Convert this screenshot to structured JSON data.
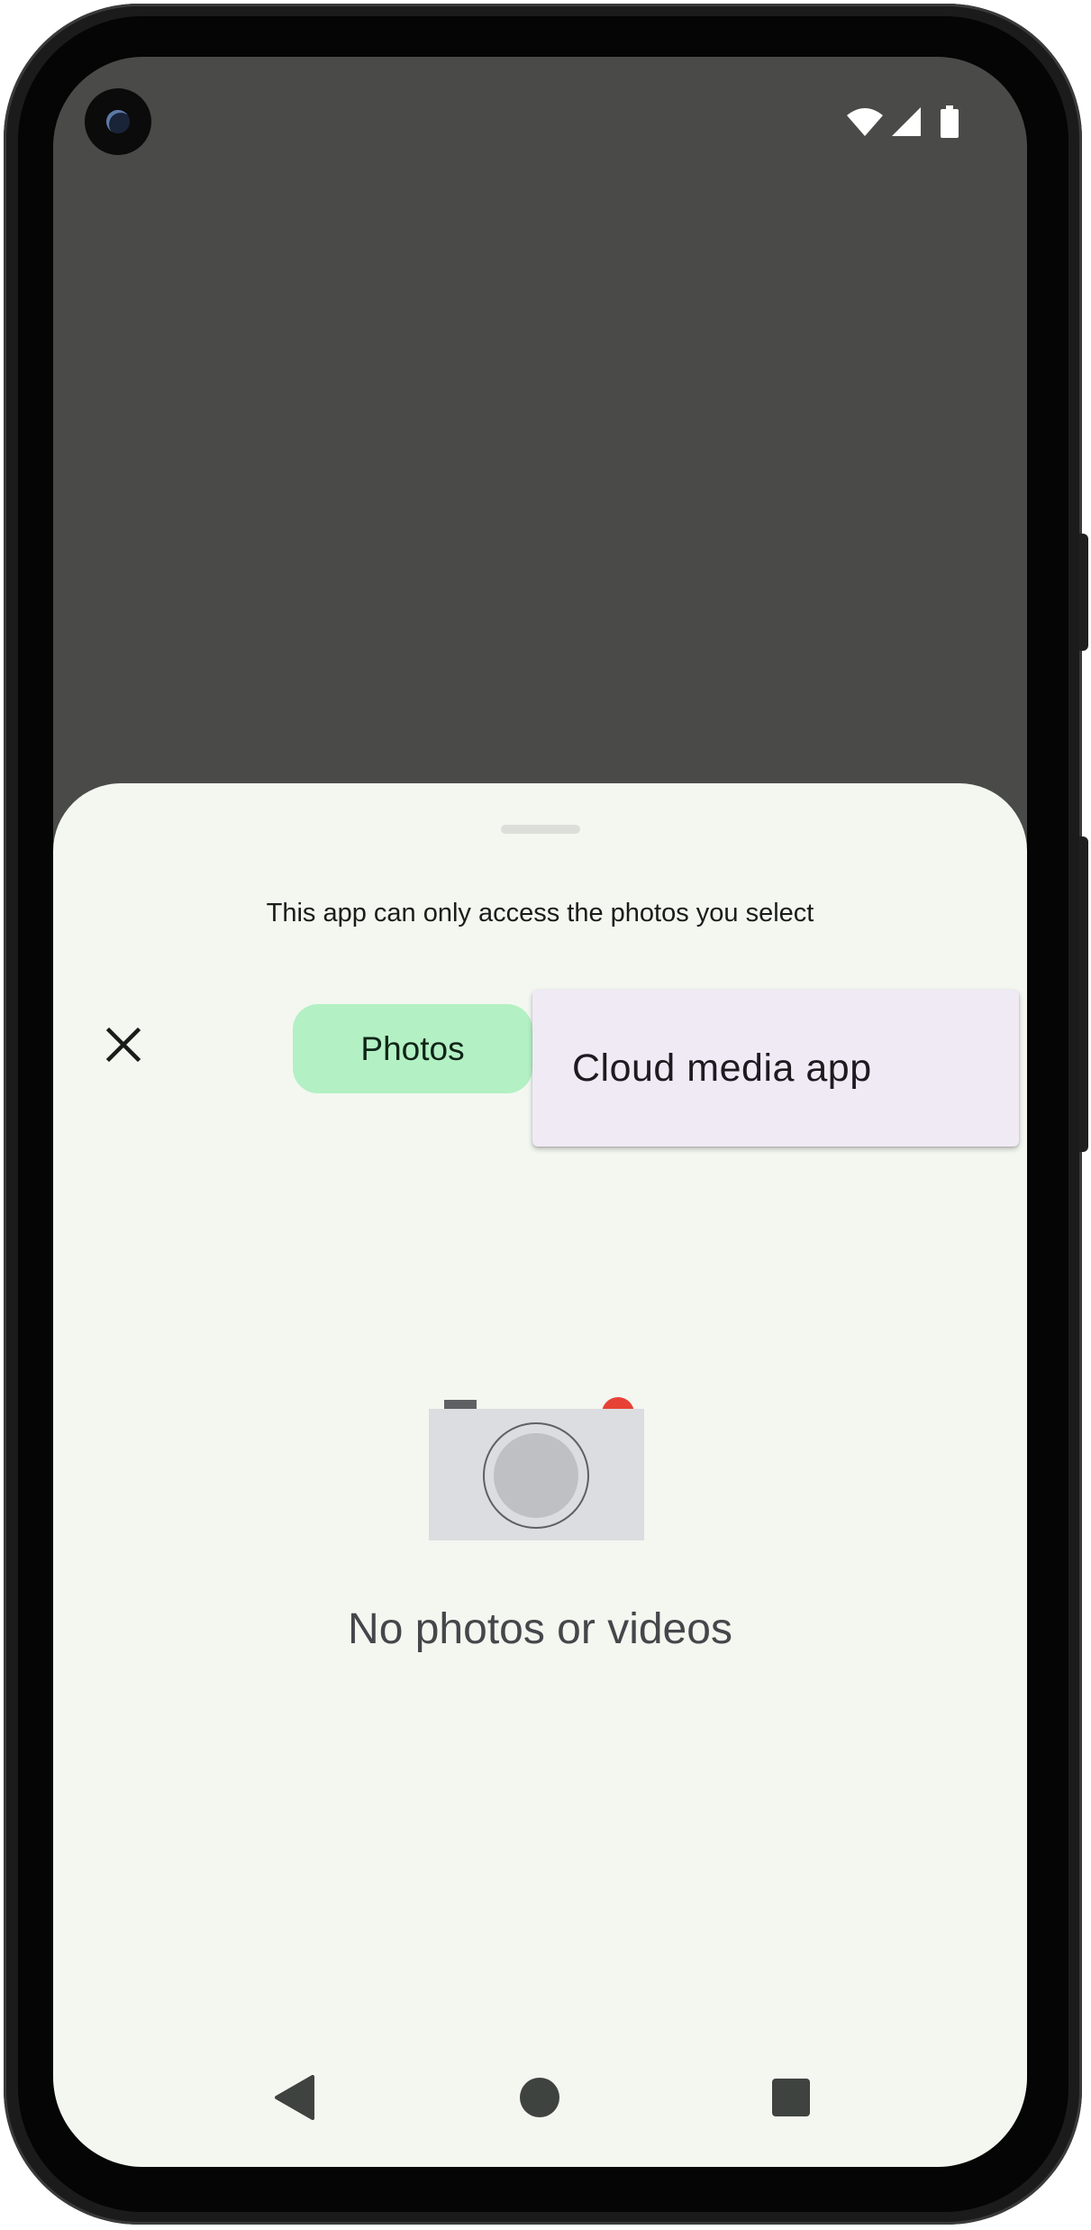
{
  "sheet": {
    "subtitle": "This app can only access the photos you select",
    "close_icon": "close-icon",
    "tabs": [
      {
        "label": "Photos",
        "selected": true
      }
    ],
    "dropdown": {
      "items": [
        {
          "label": "Cloud media app"
        }
      ]
    },
    "empty_state": {
      "illustration": "camera-illustration",
      "label": "No photos or videos"
    }
  },
  "status_bar": {
    "icons": [
      "wifi-icon",
      "cellular-signal-icon",
      "battery-icon"
    ]
  },
  "nav_bar": {
    "buttons": [
      "back-icon",
      "home-icon",
      "recents-icon"
    ]
  },
  "colors": {
    "scrim": "#4a4b49",
    "sheet_background": "#f3f7f0",
    "tab_selected": "#b3f0c4",
    "menu_background": "#f0eaf5",
    "camera_body": "#dcdde0",
    "camera_flash": "#e64235"
  }
}
